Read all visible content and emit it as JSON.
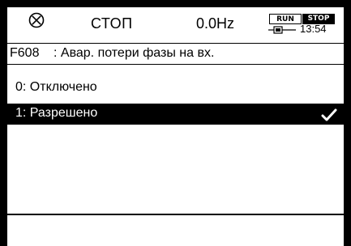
{
  "status_bar": {
    "stop_icon": "circle-x-icon",
    "state": "СТОП",
    "frequency": "0.0Hz",
    "mode_run": "RUN",
    "mode_stop": "STOP",
    "active_mode": "STOP",
    "battery_icon": "battery-icon",
    "time": "13:54"
  },
  "parameter": {
    "code": "F608",
    "title": ": Авар. потери фазы на вх."
  },
  "options": [
    {
      "label": "0: Отключено",
      "selected": false
    },
    {
      "label": "1: Разрешено",
      "selected": true,
      "icon": "checkmark-icon"
    }
  ],
  "colors": {
    "foreground": "#000000",
    "background": "#ffffff",
    "highlight": "#000000",
    "highlight_text": "#ffffff"
  }
}
